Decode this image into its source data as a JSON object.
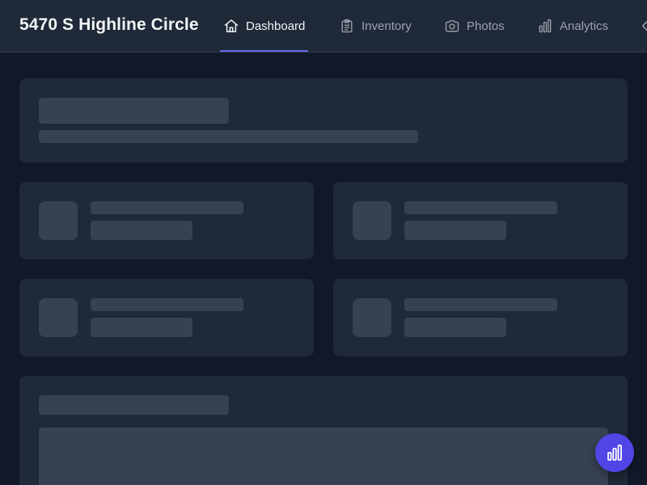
{
  "app": {
    "title": "5470 S Highline Circle"
  },
  "nav": {
    "active_tab": "dashboard",
    "tabs": [
      {
        "label": "Dashboard",
        "icon": "home-icon"
      },
      {
        "label": "Inventory",
        "icon": "clipboard-list-icon"
      },
      {
        "label": "Photos",
        "icon": "camera-icon"
      },
      {
        "label": "Analytics",
        "icon": "bar-chart-icon"
      }
    ],
    "overflow_icon": "chevron-left-icon"
  },
  "fab": {
    "icon": "bar-chart-icon"
  },
  "colors": {
    "page_background": "#111827",
    "surface": "#1f2937",
    "skeleton": "#374151",
    "accent": "#6366f1",
    "fab": "#4f46e5",
    "text_primary": "#f3f4f6",
    "text_muted": "#9ca3af"
  },
  "state": {
    "loading": true
  }
}
